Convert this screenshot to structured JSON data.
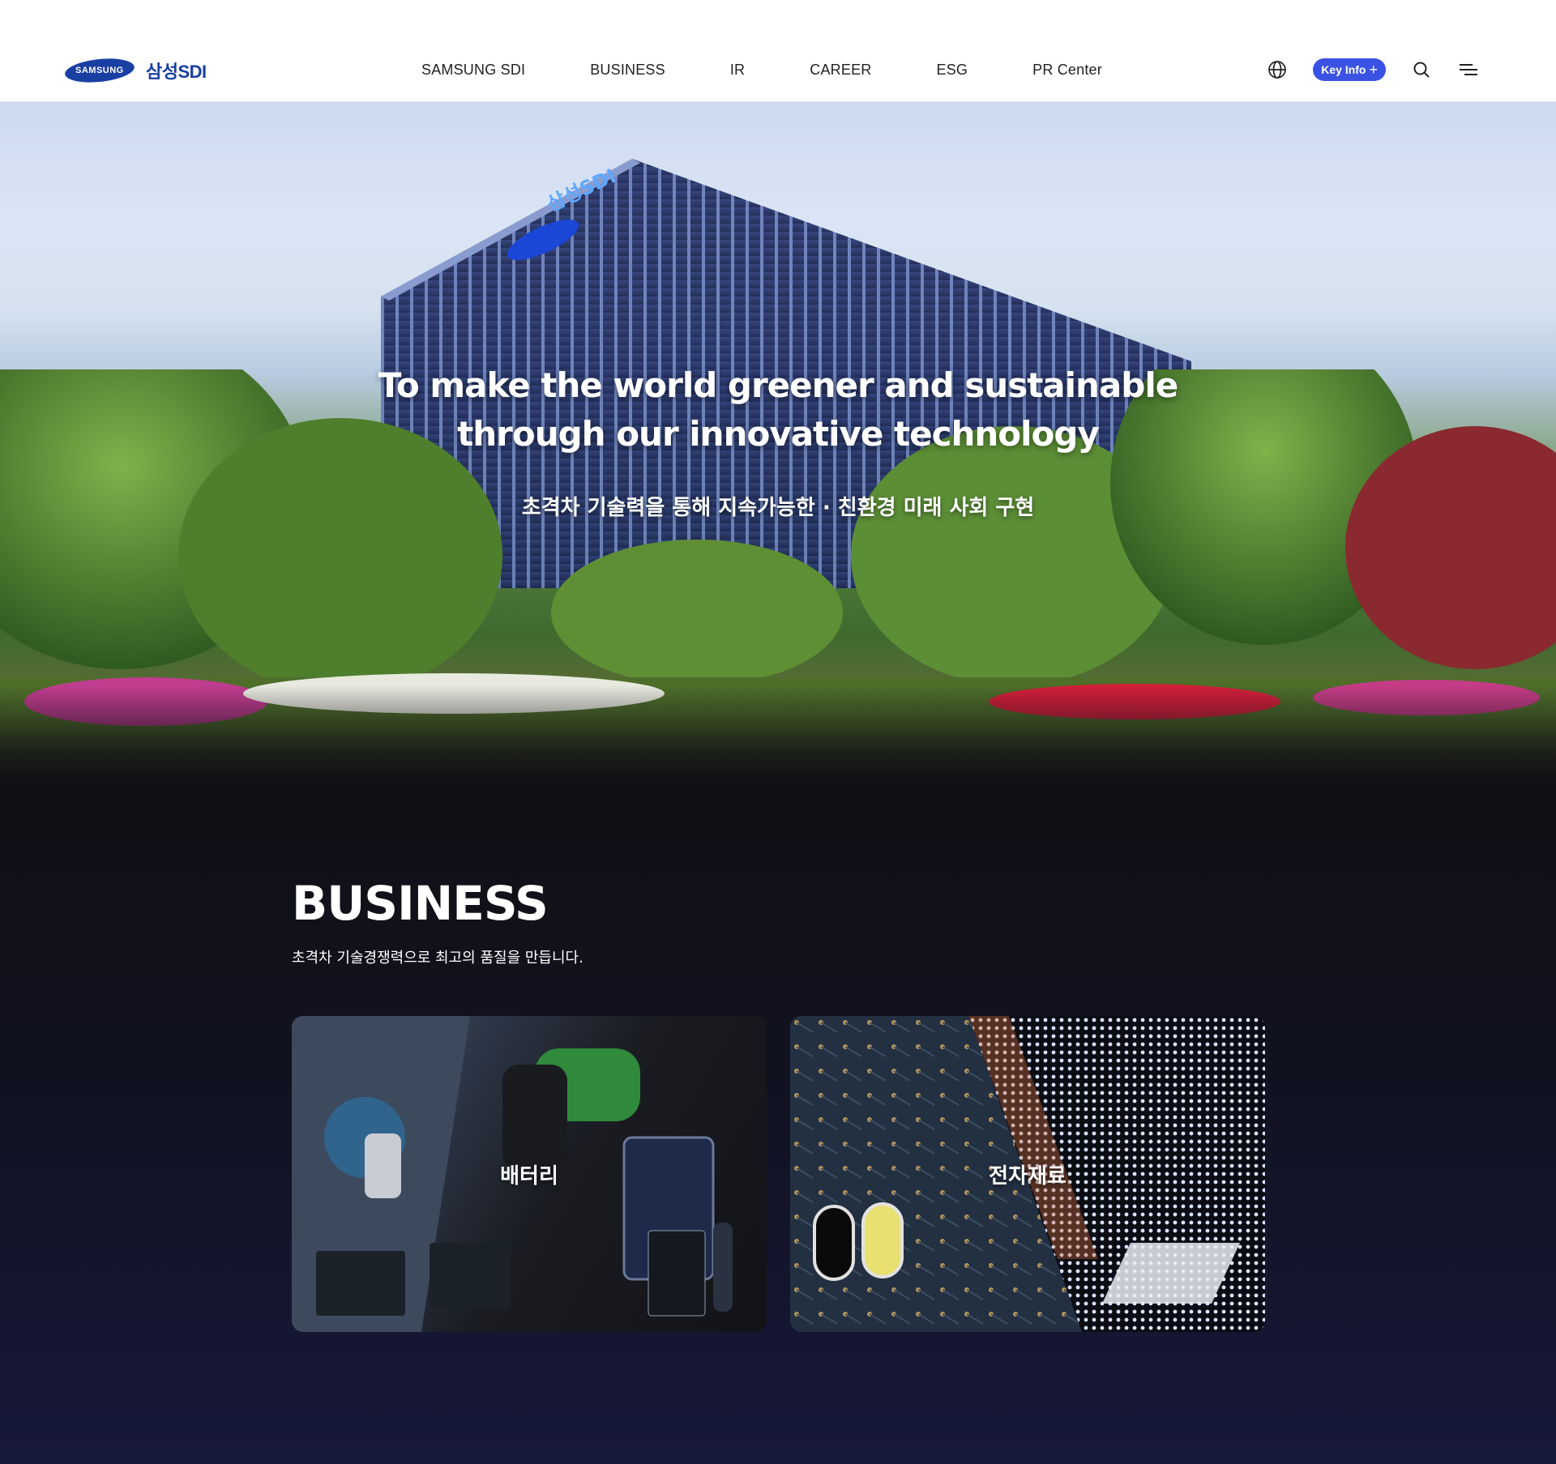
{
  "header": {
    "logo_text": "SAMSUNG",
    "logo_sdi": "삼성SDI",
    "nav": [
      "SAMSUNG SDI",
      "BUSINESS",
      "IR",
      "CAREER",
      "ESG",
      "PR Center"
    ],
    "key_info_label": "Key Info",
    "key_info_color": "#3a52e4",
    "icons": [
      "globe-icon",
      "search-icon",
      "menu-icon"
    ]
  },
  "hero": {
    "title_line1": "To make the world greener and sustainable",
    "title_line2": "through our innovative technology",
    "subtitle": "초격차 기술력을 통해 지속가능한 · 친환경 미래 사회 구현"
  },
  "business": {
    "title": "BUSINESS",
    "subtitle": "초격차 기술경쟁력으로 최고의 품질을 만듭니다.",
    "cards": [
      {
        "label": "배터리"
      },
      {
        "label": "전자재료"
      }
    ]
  },
  "colors": {
    "brand_blue": "#1a3fa3",
    "section_bg": "#111221"
  }
}
